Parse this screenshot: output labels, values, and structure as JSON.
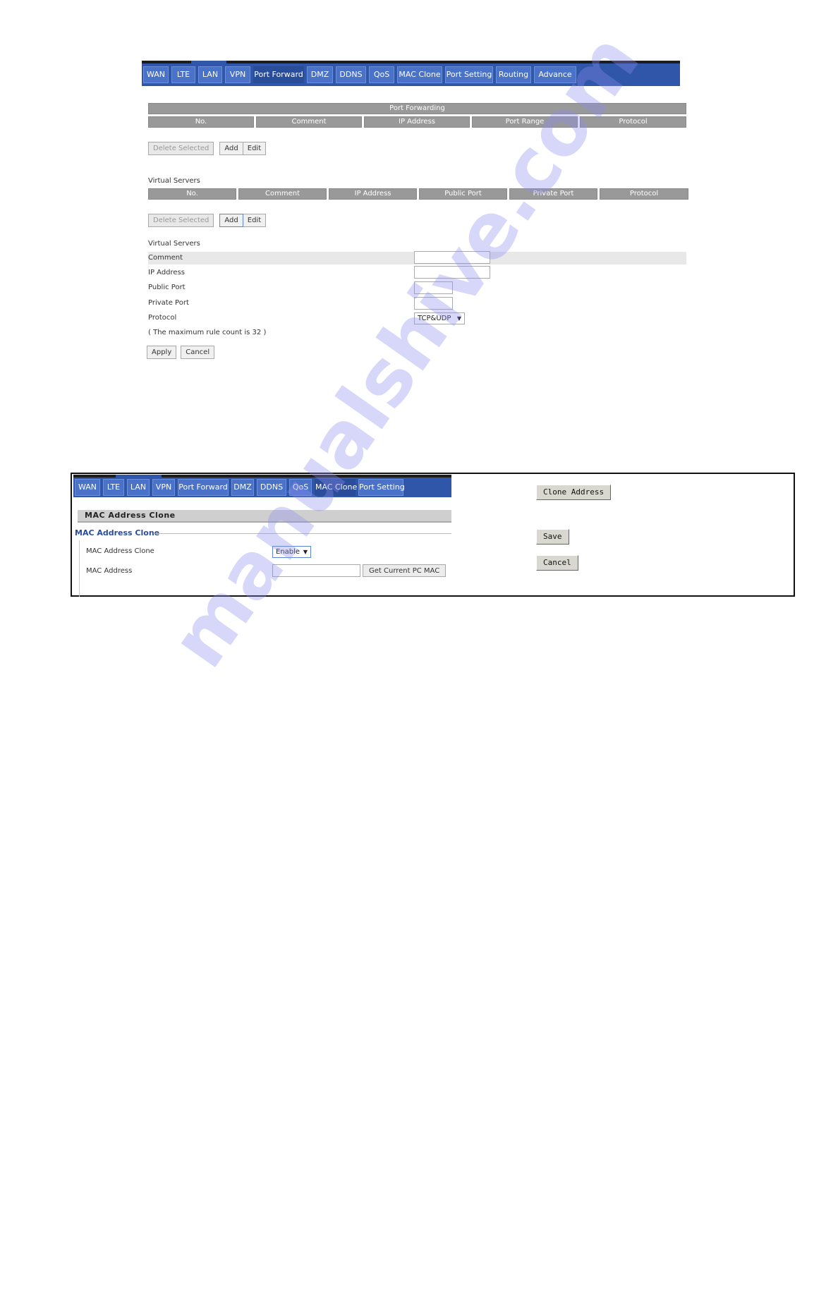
{
  "top_panel": {
    "tabs": [
      {
        "label": "WAN",
        "active": false
      },
      {
        "label": "LTE",
        "active": false
      },
      {
        "label": "LAN",
        "active": false
      },
      {
        "label": "VPN",
        "active": false
      },
      {
        "label": "Port Forward",
        "active": true
      },
      {
        "label": "DMZ",
        "active": false
      },
      {
        "label": "DDNS",
        "active": false
      },
      {
        "label": "QoS",
        "active": false
      },
      {
        "label": "MAC Clone",
        "active": false
      },
      {
        "label": "Port Setting",
        "active": false
      },
      {
        "label": "Routing",
        "active": false
      },
      {
        "label": "Advance",
        "active": false
      }
    ],
    "port_forwarding": {
      "title": "Port Forwarding",
      "columns": [
        "No.",
        "Comment",
        "IP Address",
        "Port Range",
        "Protocol"
      ],
      "rows": [],
      "buttons": {
        "delete_selected": "Delete Selected",
        "add": "Add",
        "edit": "Edit"
      }
    },
    "virtual_servers_table": {
      "title": "Virtual Servers",
      "columns": [
        "No.",
        "Comment",
        "IP Address",
        "Public Port",
        "Private Port",
        "Protocol"
      ],
      "rows": [],
      "buttons": {
        "delete_selected": "Delete Selected",
        "add": "Add",
        "edit": "Edit"
      }
    },
    "virtual_servers_form": {
      "title": "Virtual Servers",
      "fields": {
        "comment": {
          "label": "Comment",
          "value": ""
        },
        "ip_address": {
          "label": "IP Address",
          "value": ""
        },
        "public_port": {
          "label": "Public Port",
          "value": ""
        },
        "private_port": {
          "label": "Private Port",
          "value": ""
        },
        "protocol": {
          "label": "Protocol",
          "value": "TCP&UDP"
        }
      },
      "note": "( The maximum rule count is 32 )",
      "buttons": {
        "apply": "Apply",
        "cancel": "Cancel"
      }
    }
  },
  "bottom_panel": {
    "tabs": [
      {
        "label": "WAN",
        "active": false
      },
      {
        "label": "LTE",
        "active": false
      },
      {
        "label": "LAN",
        "active": false
      },
      {
        "label": "VPN",
        "active": false
      },
      {
        "label": "Port Forward",
        "active": false
      },
      {
        "label": "DMZ",
        "active": false
      },
      {
        "label": "DDNS",
        "active": false
      },
      {
        "label": "QoS",
        "active": false
      },
      {
        "label": "MAC Clone",
        "active": true
      },
      {
        "label": "Port Setting",
        "active": false
      }
    ],
    "section_title": "MAC Address Clone",
    "fieldset_legend": "MAC Address Clone",
    "fields": {
      "mac_clone": {
        "label": "MAC Address Clone",
        "value": "Enable"
      },
      "mac_address": {
        "label": "MAC Address",
        "value": ""
      }
    },
    "get_mac_button": "Get Current PC MAC",
    "side_buttons": {
      "clone_address": "Clone Address",
      "save": "Save",
      "cancel": "Cancel"
    }
  },
  "watermark": "manualshive.com",
  "colors": {
    "tab_bar": "#2f56a8",
    "tab": "#4a72c8",
    "tab_active": "#2a4d9a",
    "grid_header": "#999999",
    "legend": "#2a4d9a"
  }
}
